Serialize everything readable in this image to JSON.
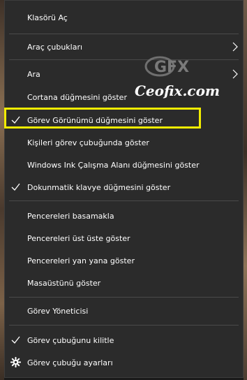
{
  "menu": {
    "items": [
      {
        "label": "Klasörü Aç"
      },
      {
        "label": "Araç çubukları"
      },
      {
        "label": "Ara"
      },
      {
        "label": "Cortana düğmesini göster"
      },
      {
        "label": "Görev Görünümü düğmesini göster"
      },
      {
        "label": "Kişileri görev çubuğunda göster"
      },
      {
        "label": "Windows Ink Çalışma Alanı düğmesini göster"
      },
      {
        "label": "Dokunmatik klavye düğmesini göster"
      },
      {
        "label": "Pencereleri basamakla"
      },
      {
        "label": "Pencereleri üst üste göster"
      },
      {
        "label": "Pencereleri yan yana göster"
      },
      {
        "label": "Masaüstünü göster"
      },
      {
        "label": "Görev Yöneticisi"
      },
      {
        "label": "Görev çubuğunu kilitle"
      },
      {
        "label": "Görev çubuğu ayarları"
      }
    ]
  },
  "watermark": {
    "logo": "GFX",
    "text": "Ceofix.com"
  },
  "colors": {
    "menu_bg": "#2b2b2b",
    "text": "#ffffff",
    "highlight": "#f2ec00",
    "separator": "#4a4a4a"
  },
  "icons": [
    "check-icon",
    "chevron-right-icon",
    "gear-icon"
  ]
}
